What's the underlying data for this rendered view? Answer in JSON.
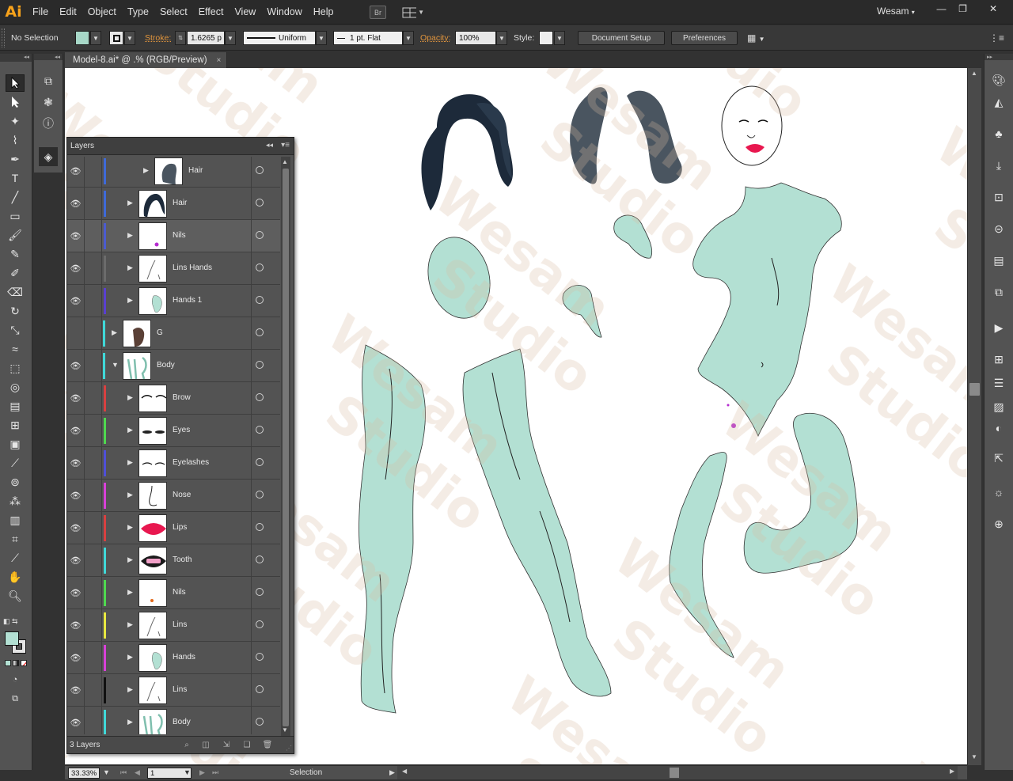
{
  "app": {
    "logo": "Ai",
    "bridge_label": "Br",
    "workspace": "Wesam"
  },
  "menu": [
    "File",
    "Edit",
    "Object",
    "Type",
    "Select",
    "Effect",
    "View",
    "Window",
    "Help"
  ],
  "window_controls": {
    "minimize": "—",
    "restore": "❐",
    "close": "✕"
  },
  "controlbar": {
    "selection": "No Selection",
    "fill_color": "#a8d8c8",
    "stroke_label": "Stroke:",
    "stroke_weight": "1.6265 p",
    "profile": "Uniform",
    "brush": "1 pt. Flat",
    "opacity_label": "Opacity:",
    "opacity": "100%",
    "style_label": "Style:",
    "document_setup": "Document Setup",
    "preferences": "Preferences"
  },
  "document": {
    "tab_title": "Model-8.ai* @ .% (RGB/Preview)",
    "close": "×"
  },
  "status": {
    "zoom": "33.33%",
    "artboard": "1",
    "tool": "Selection"
  },
  "watermark": "Wesam Studio",
  "layers_panel": {
    "title": "Layers",
    "count": "3 Layers",
    "rows": [
      {
        "name": "Hair",
        "visible": true,
        "color": "#3e6ad8",
        "indent": 2,
        "expanded": false,
        "thumb": "hair-small"
      },
      {
        "name": "Hair",
        "visible": true,
        "color": "#3e6ad8",
        "indent": 1,
        "expanded": false,
        "thumb": "hair"
      },
      {
        "name": "Nils",
        "visible": true,
        "color": "#4b5bd0",
        "indent": 1,
        "expanded": false,
        "thumb": "dot-purple",
        "highlight": true
      },
      {
        "name": "Lins Hands",
        "visible": true,
        "color": "#6b6b6b",
        "indent": 1,
        "expanded": false,
        "thumb": "lines"
      },
      {
        "name": "Hands 1",
        "visible": true,
        "color": "#5a3fd0",
        "indent": 1,
        "expanded": false,
        "thumb": "hand"
      },
      {
        "name": "G",
        "visible": false,
        "color": "#3fd8d8",
        "indent": 0,
        "expanded": false,
        "thumb": "g"
      },
      {
        "name": "Body",
        "visible": true,
        "color": "#3fd8d8",
        "indent": 0,
        "expanded": true,
        "thumb": "body"
      },
      {
        "name": "Brow",
        "visible": true,
        "color": "#d84040",
        "indent": 1,
        "expanded": false,
        "thumb": "brow"
      },
      {
        "name": "Eyes",
        "visible": true,
        "color": "#4fd84f",
        "indent": 1,
        "expanded": false,
        "thumb": "eyes"
      },
      {
        "name": "Eyelashes",
        "visible": true,
        "color": "#4f4fd8",
        "indent": 1,
        "expanded": false,
        "thumb": "eyelashes"
      },
      {
        "name": "Nose",
        "visible": true,
        "color": "#d840d8",
        "indent": 1,
        "expanded": false,
        "thumb": "nose"
      },
      {
        "name": "Lips",
        "visible": true,
        "color": "#d84040",
        "indent": 1,
        "expanded": false,
        "thumb": "lips"
      },
      {
        "name": "Tooth",
        "visible": true,
        "color": "#40d8d8",
        "indent": 1,
        "expanded": false,
        "thumb": "tooth"
      },
      {
        "name": "Nils",
        "visible": true,
        "color": "#4fd84f",
        "indent": 1,
        "expanded": false,
        "thumb": "dot-orange"
      },
      {
        "name": "Lins",
        "visible": true,
        "color": "#e8e840",
        "indent": 1,
        "expanded": false,
        "thumb": "lines"
      },
      {
        "name": "Hands",
        "visible": true,
        "color": "#d840d8",
        "indent": 1,
        "expanded": false,
        "thumb": "hand"
      },
      {
        "name": "Lins",
        "visible": true,
        "color": "#111111",
        "indent": 1,
        "expanded": false,
        "thumb": "lines"
      },
      {
        "name": "Body",
        "visible": true,
        "color": "#40d8d8",
        "indent": 1,
        "expanded": false,
        "thumb": "body"
      }
    ]
  },
  "colors": {
    "skin": "#b3e0d3",
    "hair_dark": "#1d2a3a",
    "hair_grey": "#4a5560",
    "lips": "#e8174f",
    "nils": "#b62cd0"
  }
}
